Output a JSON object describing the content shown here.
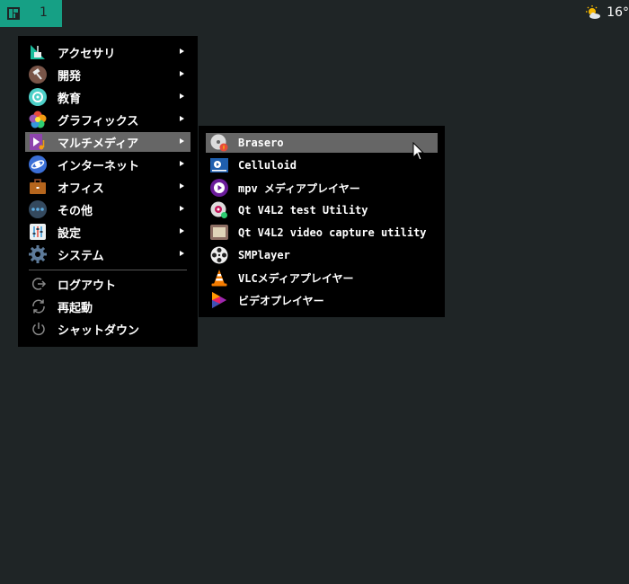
{
  "panel": {
    "workspace_number": "1",
    "weather_temp": "16°"
  },
  "menu": {
    "categories": [
      {
        "label": "アクセサリ",
        "icon": "accessories-icon"
      },
      {
        "label": "開発",
        "icon": "development-icon"
      },
      {
        "label": "教育",
        "icon": "education-icon"
      },
      {
        "label": "グラフィックス",
        "icon": "graphics-icon"
      },
      {
        "label": "マルチメディア",
        "icon": "multimedia-icon"
      },
      {
        "label": "インターネット",
        "icon": "internet-icon"
      },
      {
        "label": "オフィス",
        "icon": "office-icon"
      },
      {
        "label": "その他",
        "icon": "other-icon"
      },
      {
        "label": "設定",
        "icon": "settings-icon"
      },
      {
        "label": "システム",
        "icon": "system-icon"
      }
    ],
    "selected_category": "マルチメディア",
    "session": [
      {
        "label": "ログアウト",
        "icon": "logout-icon"
      },
      {
        "label": "再起動",
        "icon": "restart-icon"
      },
      {
        "label": "シャットダウン",
        "icon": "shutdown-icon"
      }
    ]
  },
  "submenu": {
    "items": [
      {
        "label": "Brasero",
        "icon": "brasero-icon"
      },
      {
        "label": "Celluloid",
        "icon": "celluloid-icon"
      },
      {
        "label": "mpv メディアプレイヤー",
        "icon": "mpv-icon"
      },
      {
        "label": "Qt V4L2 test Utility",
        "icon": "qv4l2-icon"
      },
      {
        "label": "Qt V4L2 video capture utility",
        "icon": "qvidcap-icon"
      },
      {
        "label": "SMPlayer",
        "icon": "smplayer-icon"
      },
      {
        "label": "VLCメディアプレイヤー",
        "icon": "vlc-icon"
      },
      {
        "label": "ビデオプレイヤー",
        "icon": "video-player-icon"
      }
    ],
    "highlighted": "Brasero"
  },
  "colors": {
    "panel_bg": "#1f2526",
    "workspace_accent": "#16a085",
    "menu_bg": "#000000",
    "selection": "#666666"
  }
}
